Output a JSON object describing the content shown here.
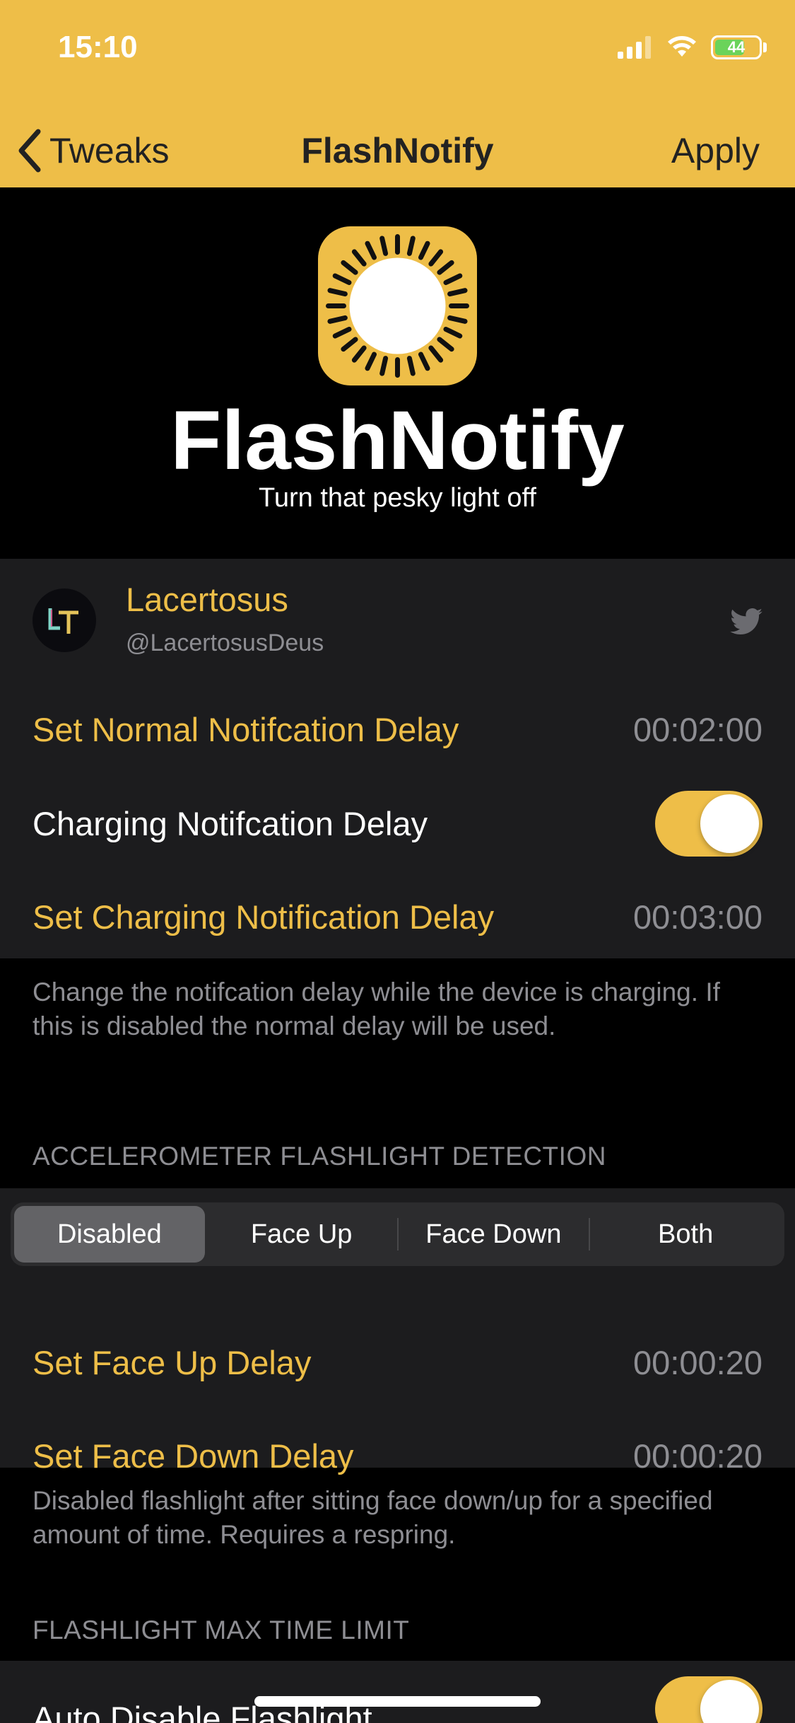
{
  "status_bar": {
    "time": "15:10",
    "battery": "44"
  },
  "nav": {
    "back_label": "Tweaks",
    "title": "FlashNotify",
    "apply_label": "Apply"
  },
  "header": {
    "app_name": "FlashNotify",
    "subtitle": "Turn that pesky light off"
  },
  "profile": {
    "name": "Lacertosus",
    "handle": "@LacertosusDeus"
  },
  "rows": {
    "normal_delay_label": "Set Normal Notifcation Delay",
    "normal_delay_value": "00:02:00",
    "charging_toggle_label": "Charging Notifcation Delay",
    "charging_toggle_on": true,
    "charging_delay_label": "Set Charging Notification Delay",
    "charging_delay_value": "00:03:00"
  },
  "charging_footer": "Change the notifcation delay while the device is charging. If this is disabled the normal delay will be used.",
  "accelerometer": {
    "section_header": "ACCELEROMETER FLASHLIGHT DETECTION",
    "segments": [
      "Disabled",
      "Face Up",
      "Face Down",
      "Both"
    ],
    "selected_segment": "Disabled",
    "face_up_label": "Set Face Up Delay",
    "face_up_value": "00:00:20",
    "face_down_label": "Set Face Down Delay",
    "face_down_value": "00:00:20",
    "footer": "Disabled flashlight after sitting face down/up for a specified amount of time. Requires a respring."
  },
  "max_time": {
    "section_header": "FLASHLIGHT MAX TIME LIMIT",
    "auto_disable_label": "Auto Disable Flashlight",
    "auto_disable_on": true
  },
  "colors": {
    "accent": "#EEBE48",
    "background": "#000000",
    "cell": "#1C1C1E",
    "secondary_text": "#8E8E93"
  }
}
